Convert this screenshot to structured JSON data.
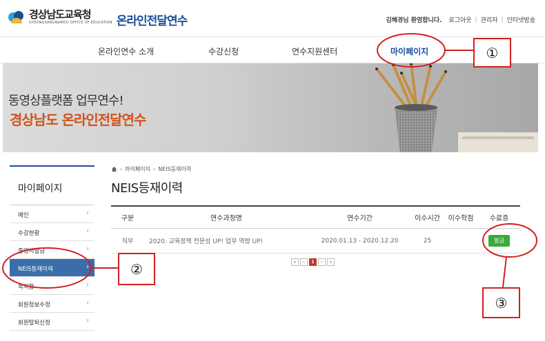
{
  "header": {
    "logo_kr": "경상남도교육청",
    "logo_en": "GYEONGSANGNAMDO OFFICE OF EDUCATION",
    "logo_sub": "온라인전달연수",
    "util": {
      "welcome": "김혜경님 환영합니다.",
      "links": [
        "로그아웃",
        "관리자",
        "인터넷방송"
      ]
    }
  },
  "gnb": {
    "items": [
      "온라인연수 소개",
      "수강신청",
      "연수지원센터",
      "마이페이지"
    ],
    "active": "마이페이지"
  },
  "banner": {
    "line1": "동영상플랫폼 업무연수!",
    "line2": "경상남도 온라인전달연수"
  },
  "sidebar": {
    "title": "마이페이지",
    "items": [
      {
        "label": "메인"
      },
      {
        "label": "수강현황"
      },
      {
        "label": "증명서발급"
      },
      {
        "label": "NEIS등재이력",
        "active": true
      },
      {
        "label": "쪽지함"
      },
      {
        "label": "회원정보수정"
      },
      {
        "label": "회원탈퇴신청"
      }
    ]
  },
  "breadcrumb": [
    "마이페이지",
    "NEIS등재이력"
  ],
  "page_title": "NEIS등재이력",
  "table": {
    "headers": [
      "구분",
      "연수과정명",
      "연수기간",
      "이수시간",
      "이수학점",
      "수료증"
    ],
    "rows": [
      {
        "type": "직무",
        "name": "2020. 교육정책 전문성 UP! 업무 역량 UP!",
        "period": "2020.01.13 - 2020.12.20",
        "hours": "25",
        "credit": "",
        "cert_button": "발급"
      }
    ]
  },
  "pagination": {
    "first": "«",
    "prev": "‹",
    "current": "1",
    "next": "›",
    "last": "»"
  },
  "annotations": [
    "①",
    "②",
    "③"
  ],
  "colors": {
    "brand_blue": "#1b4f99",
    "accent_orange": "#d2521b",
    "sidebar_active": "#3a6eaa",
    "issue_green": "#3aaa3a",
    "annotation_red": "#d02020"
  }
}
